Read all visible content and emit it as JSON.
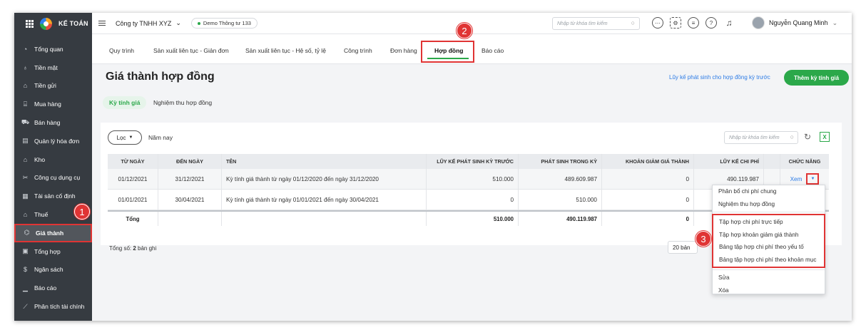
{
  "app": {
    "logo_text": "KẾ TOÁN"
  },
  "sidebar": {
    "items": [
      {
        "label": "Tổng quan",
        "icon": "dashboard-icon",
        "glyph": "◔"
      },
      {
        "label": "Tiền mặt",
        "icon": "cash-icon",
        "glyph": "♁"
      },
      {
        "label": "Tiền gửi",
        "icon": "bank-icon",
        "glyph": "⌂"
      },
      {
        "label": "Mua hàng",
        "icon": "purchase-icon",
        "glyph": "⌸"
      },
      {
        "label": "Bán hàng",
        "icon": "cart-icon",
        "glyph": "⛟"
      },
      {
        "label": "Quản lý hóa đơn",
        "icon": "invoice-icon",
        "glyph": "▤"
      },
      {
        "label": "Kho",
        "icon": "warehouse-icon",
        "glyph": "⌂"
      },
      {
        "label": "Công cụ dụng cụ",
        "icon": "tools-icon",
        "glyph": "✂"
      },
      {
        "label": "Tài sản cố định",
        "icon": "asset-icon",
        "glyph": "▦"
      },
      {
        "label": "Thuế",
        "icon": "tax-icon",
        "glyph": "⌂"
      },
      {
        "label": "Giá thành",
        "icon": "tag-icon",
        "glyph": "⌬",
        "active": true
      },
      {
        "label": "Tổng hợp",
        "icon": "summary-icon",
        "glyph": "▣"
      },
      {
        "label": "Ngân sách",
        "icon": "budget-icon",
        "glyph": "$"
      },
      {
        "label": "Báo cáo",
        "icon": "report-icon",
        "glyph": "▁"
      },
      {
        "label": "Phân tích tài chính",
        "icon": "analysis-icon",
        "glyph": "⟋"
      }
    ]
  },
  "topbar": {
    "company": "Công ty TNHH XYZ",
    "demo": "Demo Thông tư 133",
    "search_placeholder": "Nhập từ khóa tìm kiếm",
    "user_name": "Nguyễn Quang Minh"
  },
  "tabs": [
    "Quy trình",
    "Sản xuất liên tục - Giản đơn",
    "Sản xuất liên tục - Hệ số, tỷ lệ",
    "Công trình",
    "Đơn hàng",
    "Hợp đồng",
    "Báo cáo"
  ],
  "page": {
    "title": "Giá thành hợp đồng",
    "prev_link": "Lũy kế phát sinh cho hợp đồng kỳ trước",
    "add_button": "Thêm kỳ tính giá",
    "subtabs": [
      "Kỳ tính giá",
      "Nghiệm thu hợp đồng"
    ]
  },
  "filter": {
    "label": "Lọc",
    "period": "Năm nay",
    "search_placeholder": "Nhập từ khóa tìm kiếm"
  },
  "table": {
    "headers": [
      "TỪ NGÀY",
      "ĐẾN NGÀY",
      "TÊN",
      "LŨY KẾ PHÁT SINH KỲ TRƯỚC",
      "PHÁT SINH TRONG KỲ",
      "KHOẢN GIẢM GIÁ THÀNH",
      "LŨY KẾ CHI PHÍ",
      "",
      "CHỨC NĂNG"
    ],
    "rows": [
      [
        "01/12/2021",
        "31/12/2021",
        "Kỳ tính giá thành từ ngày 01/12/2020 đến ngày 31/12/2020",
        "510.000",
        "489.609.987",
        "0",
        "490.119.987"
      ],
      [
        "01/01/2021",
        "30/04/2021",
        "Kỳ tính giá thành từ ngày 01/01/2021 đến ngày 30/04/2021",
        "0",
        "510.000",
        "0",
        ""
      ]
    ],
    "action_label": "Xem",
    "footer": {
      "label": "Tổng",
      "prev": "510.000",
      "period": "490.119.987",
      "reduce": "0"
    },
    "total_prefix": "Tổng số: ",
    "total_count": "2",
    "total_suffix": " bản ghi",
    "page_size": "20 bản"
  },
  "dropdown": {
    "top": [
      "Phân bổ chi phí chung",
      "Nghiệm thu hợp đồng"
    ],
    "highlighted": [
      "Tập hợp chi phí trực tiếp",
      "Tập hợp khoản giảm giá thành",
      "Bảng tập hợp chi phí theo yếu tố",
      "Bảng tập hợp chi phí theo khoản mục"
    ],
    "bottom": [
      "Sửa",
      "Xóa"
    ]
  },
  "annotations": [
    "1",
    "2",
    "3"
  ],
  "colors": {
    "accent_green": "#2ba84a",
    "highlight_red": "#e03434",
    "link_blue": "#2c7be5",
    "sidebar_bg": "#363b41"
  }
}
